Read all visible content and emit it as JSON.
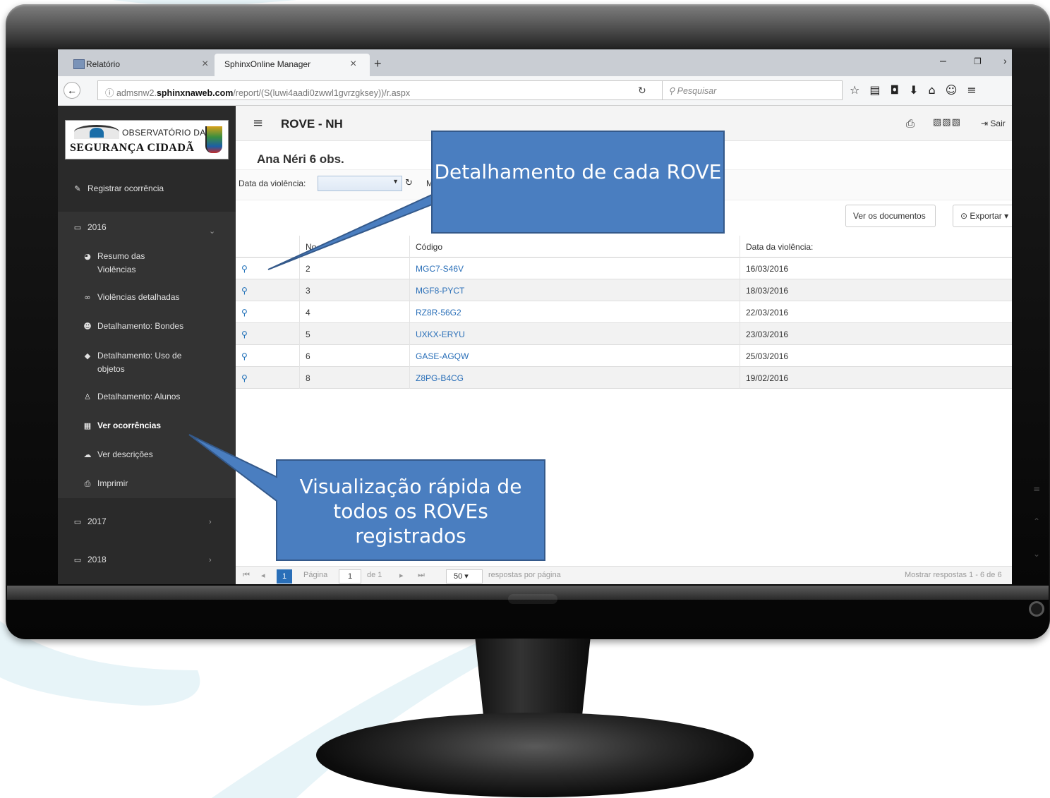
{
  "browser": {
    "tabs": [
      {
        "label": "Relatório"
      },
      {
        "label": "SphinxOnline Manager"
      }
    ],
    "url_prefix": "admsnw2.",
    "url_domain": "sphinxnaweb.com",
    "url_path": "/report/(S(luwi4aadi0zwwl1gvrzgksey))/r.aspx",
    "search_placeholder": "Pesquisar"
  },
  "sidebar": {
    "logo_line1": "OBSERVATÓRIO DA",
    "logo_line2": "SEGURANÇA CIDADÃ",
    "register": "Registrar ocorrência",
    "years": [
      "2016",
      "2017",
      "2018"
    ],
    "items": [
      {
        "label": "Resumo das",
        "label2": "Violências",
        "icon": "pie-chart-icon"
      },
      {
        "label": "Violências detalhadas",
        "icon": "binoculars-icon"
      },
      {
        "label": "Detalhamento: Bondes",
        "icon": "group-icon"
      },
      {
        "label": "Detalhamento: Uso de",
        "label2": "objetos",
        "icon": "tag-icon"
      },
      {
        "label": "Detalhamento: Alunos",
        "icon": "person-icon"
      },
      {
        "label": "Ver ocorrências",
        "icon": "table-icon"
      },
      {
        "label": "Ver descrições",
        "icon": "comments-icon"
      },
      {
        "label": "Imprimir",
        "icon": "print-icon"
      }
    ]
  },
  "header": {
    "title": "ROVE - NH",
    "logout": "Sair"
  },
  "subtitle": "Ana Néri 6 obs.",
  "filter": {
    "label": "Data da violência:",
    "more": "M"
  },
  "buttons": {
    "ver_documentos": "Ver os documentos",
    "exportar": "Exportar"
  },
  "grid": {
    "columns": [
      "",
      "No",
      "Código",
      "Data da violência:"
    ],
    "rows": [
      {
        "no": "2",
        "codigo": "MGC7-S46V",
        "data": "16/03/2016"
      },
      {
        "no": "3",
        "codigo": "MGF8-PYCT",
        "data": "18/03/2016"
      },
      {
        "no": "4",
        "codigo": "RZ8R-56G2",
        "data": "22/03/2016"
      },
      {
        "no": "5",
        "codigo": "UXKX-ERYU",
        "data": "23/03/2016"
      },
      {
        "no": "6",
        "codigo": "GASE-AGQW",
        "data": "25/03/2016"
      },
      {
        "no": "8",
        "codigo": "Z8PG-B4CG",
        "data": "19/02/2016"
      }
    ]
  },
  "pager": {
    "current": "1",
    "page_label": "Página",
    "page_value": "1",
    "of_label": "de 1",
    "page_size": "50",
    "per_page_label": "respostas por página",
    "summary": "Mostrar respostas 1 - 6 de 6"
  },
  "callouts": {
    "detail": "Detalhamento de cada ROVE",
    "quick_line1": "Visualização rápida de",
    "quick_line2": "todos os ROVEs",
    "quick_line3": "registrados"
  },
  "colors": {
    "callout_fill": "#4a7ec0",
    "callout_border": "#34598a",
    "link": "#2a6fb8",
    "sidebar": "#2a2a2a"
  }
}
